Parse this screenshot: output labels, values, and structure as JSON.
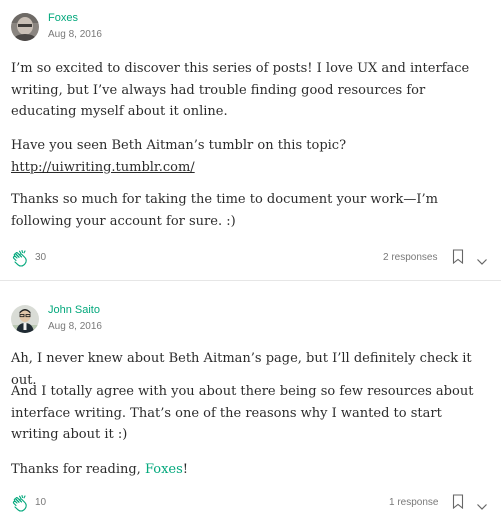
{
  "responses": [
    {
      "author": "Foxes",
      "date": "Aug 8, 2016",
      "avatar_icon": "user-photo",
      "paragraphs": [
        "I’m so excited to discover this series of posts! I love UX and interface writing, but I’ve always had trouble finding good resources for educating myself about it online.",
        "Have you seen Beth Aitman’s tumblr on this topic?",
        "Thanks so much for taking the time to document your work—I’m following your account for sure. :)"
      ],
      "link_text": "http://uiwriting.tumblr.com/",
      "claps": "30",
      "responses_label": "2 responses"
    },
    {
      "author": "John Saito",
      "date": "Aug 8, 2016",
      "avatar_icon": "user-photo",
      "paragraphs": [
        "Ah, I never knew about Beth Aitman’s page, but I’ll definitely check it out.",
        "And I totally agree with you about there being so few resources about interface writing. That’s one of the reasons why I wanted to start writing about it :)"
      ],
      "thanks_prefix": "Thanks for reading, ",
      "thanks_mention": "Foxes",
      "thanks_suffix": "!",
      "claps": "10",
      "responses_label": "1 response"
    }
  ],
  "colors": {
    "accent": "#03a87c",
    "text": "#292929",
    "muted": "#757575",
    "divider": "#e6e6e6"
  },
  "icons": [
    "clap-icon",
    "bookmark-icon",
    "chevron-down-icon"
  ]
}
